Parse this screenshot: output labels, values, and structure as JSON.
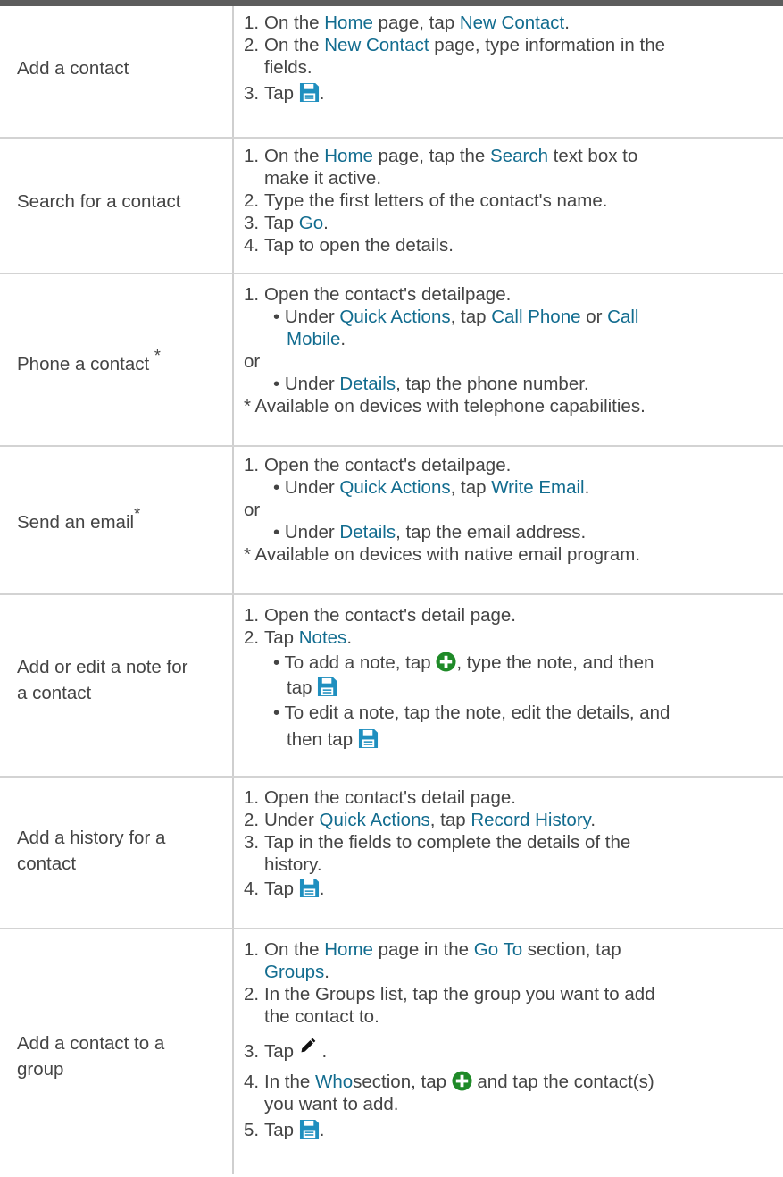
{
  "rows": [
    {
      "task": "Add a contact",
      "s1_a": "On the ",
      "s1_link1": "Home",
      "s1_b": " page, tap ",
      "s1_link2": "New Contact",
      "s1_c": ".",
      "s2_a": "On the ",
      "s2_link1": "New Contact",
      "s2_b": " page, type information in the",
      "s2_c": "fields.",
      "s3_a": "Tap ",
      "s3_icon": "save-icon"
    },
    {
      "task": "Search for a contact",
      "s1_a": "On the ",
      "s1_link1": "Home",
      "s1_b": " page, tap the ",
      "s1_link2": "Search",
      "s1_c": " text box to",
      "s1_d": "make it active.",
      "s2": "Type the first letters of the contact's name.",
      "s3_a": "Tap ",
      "s3_link": "Go",
      "s3_b": ".",
      "s4": "Tap to open the details."
    },
    {
      "task": "Phone a contact",
      "task_star": "*",
      "s1": "Open the contact's detailpage.",
      "b1_a": "• Under ",
      "b1_link1": "Quick Actions",
      "b1_b": ", tap ",
      "b1_link2": "Call Phone",
      "b1_c": " or ",
      "b1_link3": "Call",
      "b1_link4": "Mobile",
      "b1_d": ".",
      "or": "or",
      "b2_a": "• Under ",
      "b2_link": "Details",
      "b2_b": ", tap the phone number.",
      "note": "* Available on devices with telephone capabilities."
    },
    {
      "task": "Send an email",
      "task_star": "*",
      "s1": "Open the contact's detailpage.",
      "b1_a": "• Under ",
      "b1_link1": "Quick Actions",
      "b1_b": ", tap ",
      "b1_link2": "Write Email",
      "b1_c": ".",
      "or": "or",
      "b2_a": "• Under ",
      "b2_link": "Details",
      "b2_b": ", tap the email address.",
      "note": "* Available on devices with native email program."
    },
    {
      "task": "Add or edit a note for",
      "task2": "a contact",
      "s1": "Open the contact's detail page.",
      "s2_a": "Tap ",
      "s2_link": "Notes",
      "s2_b": ".",
      "b1_a": "• To add a note, tap ",
      "b1_b": ", type the note, and then",
      "b1_c": "tap ",
      "b2_a": "• To edit a note, tap the note, edit the details, and",
      "b2_b": "then tap "
    },
    {
      "task": "Add a history for a",
      "task2": "contact",
      "s1": "Open the contact's detail page.",
      "s2_a": "Under ",
      "s2_link1": "Quick Actions",
      "s2_b": ", tap ",
      "s2_link2": "Record History",
      "s2_c": ".",
      "s3_a": "Tap in the fields to complete the details of the",
      "s3_b": "history.",
      "s4_a": "Tap "
    },
    {
      "task": "Add a contact to a",
      "task2": "group",
      "s1_a": "On the ",
      "s1_link1": "Home",
      "s1_b": " page in the ",
      "s1_link2": "Go To",
      "s1_c": " section, tap",
      "s1_link3": "Groups",
      "s1_d": ".",
      "s2_a": "In the Groups list, tap the group you want to add",
      "s2_b": "the contact to.",
      "s3_a": "Tap ",
      "s3_b": " .",
      "s4_a": "In the ",
      "s4_link": "Who",
      "s4_b": "section, tap ",
      "s4_c": "and tap the contact(s)",
      "s4_d": "you want to add.",
      "s5_a": "Tap "
    }
  ],
  "nums": [
    "1.",
    "2.",
    "3.",
    "4.",
    "5."
  ],
  "colors": {
    "link": "#126c8f",
    "icon": "#1f8fbf",
    "plus": "#1f8a28",
    "rule": "#d3d3d3",
    "topbar": "#5d5d5d"
  }
}
